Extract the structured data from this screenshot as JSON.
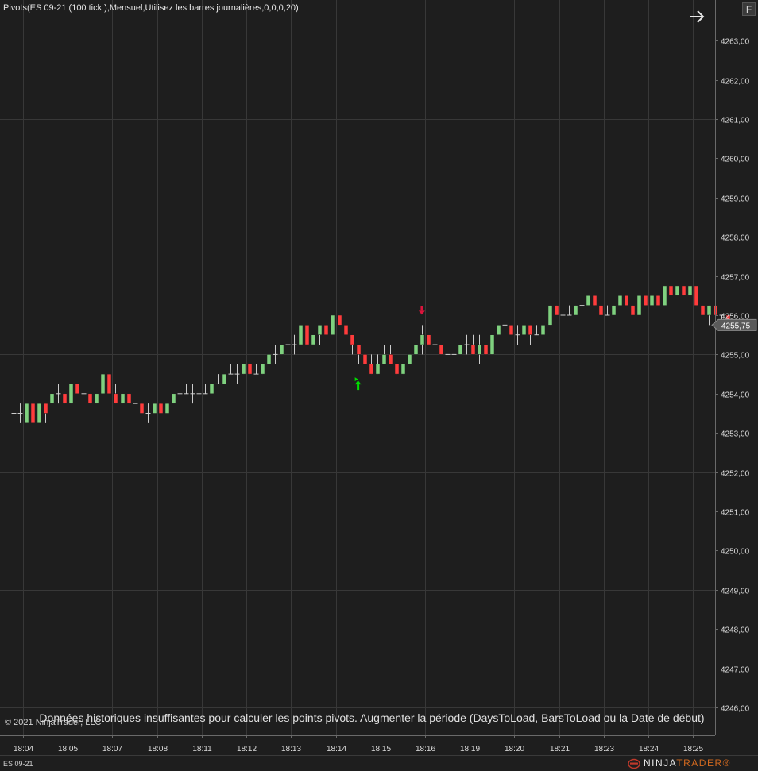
{
  "indicator_title": "Pivots(ES 09-21 (100 tick ),Mensuel,Utilisez les barres journalières,0,0,0,20)",
  "f_button": "F",
  "copyright": "© 2021 NinjaTrader, LLC",
  "warning": "Données historiques insuffisantes pour calculer les points pivots. Augmenter la période (DaysToLoad, BarsToLoad ou la Date de début)",
  "instrument": "ES 09-21",
  "brand": {
    "part1": "NINJA",
    "part2": "TRADER",
    "registered": "®"
  },
  "icons": {
    "scroll": "arrow-right-icon",
    "brand": "ninjatrader-logo-icon",
    "pivot_down": "arrow-down-icon",
    "pivot_up": "arrow-up-icon"
  },
  "colors": {
    "background": "#1e1e1e",
    "grid": "#383838",
    "up": "#7fd17f",
    "down": "#ff3c3c",
    "doji": "#cccccc",
    "arrow_up": "#00dd00",
    "arrow_down": "#dc143c",
    "price_tag": "#5a5a5a"
  },
  "chart_data": {
    "type": "candlestick",
    "instrument": "ES 09-21",
    "bar_period": "100 tick",
    "tick_size": 0.25,
    "ylim": [
      4245.5,
      4263.75
    ],
    "y_ticks": [
      4246.0,
      4247.0,
      4248.0,
      4249.0,
      4250.0,
      4251.0,
      4252.0,
      4253.0,
      4254.0,
      4255.0,
      4256.0,
      4257.0,
      4258.0,
      4259.0,
      4260.0,
      4261.0,
      4262.0,
      4263.0
    ],
    "y_tick_labels": [
      "4246,00",
      "4247,00",
      "4248,00",
      "4249,00",
      "4250,00",
      "4251,00",
      "4252,00",
      "4253,00",
      "4254,00",
      "4255,00",
      "4256,00",
      "4257,00",
      "4258,00",
      "4259,00",
      "4260,00",
      "4261,00",
      "4262,00",
      "4263,00"
    ],
    "x_ticks": [
      {
        "label": "18:04",
        "bar": 1.5
      },
      {
        "label": "18:05",
        "bar": 8.5
      },
      {
        "label": "18:07",
        "bar": 15.5
      },
      {
        "label": "18:08",
        "bar": 22.5
      },
      {
        "label": "18:11",
        "bar": 29.5
      },
      {
        "label": "18:12",
        "bar": 36.5
      },
      {
        "label": "18:13",
        "bar": 43.5
      },
      {
        "label": "18:14",
        "bar": 50.5
      },
      {
        "label": "18:15",
        "bar": 57.5
      },
      {
        "label": "18:16",
        "bar": 64.5
      },
      {
        "label": "18:19",
        "bar": 71.5
      },
      {
        "label": "18:20",
        "bar": 78.5
      },
      {
        "label": "18:21",
        "bar": 85.5
      },
      {
        "label": "18:23",
        "bar": 92.5
      },
      {
        "label": "18:24",
        "bar": 99.5
      },
      {
        "label": "18:25",
        "bar": 106.5
      }
    ],
    "grid": true,
    "last_price": 4255.75,
    "last_price_label": "4255,75",
    "ohlc": [
      [
        4253.5,
        4253.75,
        4253.25,
        4253.5
      ],
      [
        4253.5,
        4253.75,
        4253.25,
        4253.5
      ],
      [
        4253.25,
        4253.75,
        4253.25,
        4253.75
      ],
      [
        4253.75,
        4253.75,
        4253.25,
        4253.25
      ],
      [
        4253.25,
        4253.75,
        4253.25,
        4253.75
      ],
      [
        4253.75,
        4253.75,
        4253.25,
        4253.5
      ],
      [
        4253.75,
        4254.0,
        4253.75,
        4254.0
      ],
      [
        4254.0,
        4254.25,
        4253.75,
        4254.0
      ],
      [
        4254.0,
        4254.0,
        4253.75,
        4253.75
      ],
      [
        4253.75,
        4254.25,
        4253.75,
        4254.25
      ],
      [
        4254.25,
        4254.25,
        4254.0,
        4254.0
      ],
      [
        4254.0,
        4254.0,
        4254.0,
        4254.0
      ],
      [
        4254.0,
        4254.0,
        4253.75,
        4253.75
      ],
      [
        4253.75,
        4254.0,
        4253.75,
        4254.0
      ],
      [
        4254.0,
        4254.5,
        4254.0,
        4254.5
      ],
      [
        4254.5,
        4254.5,
        4254.0,
        4254.0
      ],
      [
        4254.0,
        4254.25,
        4253.75,
        4253.75
      ],
      [
        4253.75,
        4254.0,
        4253.75,
        4254.0
      ],
      [
        4254.0,
        4254.0,
        4253.75,
        4253.75
      ],
      [
        4253.75,
        4253.75,
        4253.75,
        4253.75
      ],
      [
        4253.75,
        4253.75,
        4253.5,
        4253.5
      ],
      [
        4253.5,
        4253.75,
        4253.25,
        4253.5
      ],
      [
        4253.5,
        4253.75,
        4253.5,
        4253.75
      ],
      [
        4253.75,
        4253.75,
        4253.5,
        4253.5
      ],
      [
        4253.5,
        4253.75,
        4253.5,
        4253.75
      ],
      [
        4253.75,
        4254.0,
        4253.75,
        4254.0
      ],
      [
        4254.0,
        4254.25,
        4254.0,
        4254.0
      ],
      [
        4254.0,
        4254.25,
        4254.0,
        4254.0
      ],
      [
        4254.0,
        4254.25,
        4253.75,
        4254.0
      ],
      [
        4254.0,
        4254.0,
        4253.75,
        4254.0
      ],
      [
        4254.0,
        4254.25,
        4254.0,
        4254.0
      ],
      [
        4254.0,
        4254.25,
        4254.0,
        4254.25
      ],
      [
        4254.25,
        4254.5,
        4254.25,
        4254.25
      ],
      [
        4254.25,
        4254.5,
        4254.25,
        4254.5
      ],
      [
        4254.5,
        4254.75,
        4254.5,
        4254.5
      ],
      [
        4254.5,
        4254.75,
        4254.25,
        4254.5
      ],
      [
        4254.5,
        4254.75,
        4254.5,
        4254.75
      ],
      [
        4254.75,
        4254.75,
        4254.5,
        4254.5
      ],
      [
        4254.5,
        4254.75,
        4254.5,
        4254.5
      ],
      [
        4254.5,
        4254.75,
        4254.5,
        4254.75
      ],
      [
        4254.75,
        4255.0,
        4254.75,
        4255.0
      ],
      [
        4255.0,
        4255.25,
        4254.75,
        4255.0
      ],
      [
        4255.0,
        4255.25,
        4255.0,
        4255.25
      ],
      [
        4255.25,
        4255.5,
        4255.25,
        4255.25
      ],
      [
        4255.25,
        4255.5,
        4255.0,
        4255.25
      ],
      [
        4255.25,
        4255.75,
        4255.25,
        4255.75
      ],
      [
        4255.75,
        4255.75,
        4255.25,
        4255.25
      ],
      [
        4255.25,
        4255.5,
        4255.25,
        4255.5
      ],
      [
        4255.5,
        4255.75,
        4255.25,
        4255.75
      ],
      [
        4255.75,
        4255.75,
        4255.5,
        4255.5
      ],
      [
        4255.5,
        4256.0,
        4255.5,
        4256.0
      ],
      [
        4256.0,
        4256.0,
        4255.75,
        4255.75
      ],
      [
        4255.75,
        4255.75,
        4255.25,
        4255.5
      ],
      [
        4255.5,
        4255.5,
        4255.0,
        4255.25
      ],
      [
        4255.25,
        4255.25,
        4254.75,
        4255.0
      ],
      [
        4255.0,
        4255.0,
        4254.5,
        4254.75
      ],
      [
        4254.75,
        4255.0,
        4254.5,
        4254.5
      ],
      [
        4254.5,
        4255.0,
        4254.5,
        4254.75
      ],
      [
        4254.75,
        4255.25,
        4254.75,
        4255.0
      ],
      [
        4255.0,
        4255.25,
        4254.75,
        4254.75
      ],
      [
        4254.75,
        4254.75,
        4254.5,
        4254.5
      ],
      [
        4254.5,
        4254.75,
        4254.5,
        4254.75
      ],
      [
        4254.75,
        4255.0,
        4254.75,
        4255.0
      ],
      [
        4255.0,
        4255.25,
        4255.0,
        4255.25
      ],
      [
        4255.25,
        4255.75,
        4255.0,
        4255.5
      ],
      [
        4255.5,
        4255.5,
        4255.25,
        4255.25
      ],
      [
        4255.25,
        4255.5,
        4255.0,
        4255.25
      ],
      [
        4255.25,
        4255.25,
        4255.0,
        4255.0
      ],
      [
        4255.0,
        4255.0,
        4255.0,
        4255.0
      ],
      [
        4255.0,
        4255.0,
        4255.0,
        4255.0
      ],
      [
        4255.0,
        4255.25,
        4255.0,
        4255.25
      ],
      [
        4255.25,
        4255.5,
        4255.0,
        4255.25
      ],
      [
        4255.25,
        4255.5,
        4255.0,
        4255.0
      ],
      [
        4255.0,
        4255.5,
        4254.75,
        4255.25
      ],
      [
        4255.25,
        4255.25,
        4255.0,
        4255.0
      ],
      [
        4255.0,
        4255.5,
        4255.0,
        4255.5
      ],
      [
        4255.5,
        4255.75,
        4255.5,
        4255.75
      ],
      [
        4255.75,
        4255.75,
        4255.25,
        4255.75
      ],
      [
        4255.75,
        4255.75,
        4255.5,
        4255.5
      ],
      [
        4255.5,
        4255.75,
        4255.25,
        4255.5
      ],
      [
        4255.5,
        4255.75,
        4255.5,
        4255.75
      ],
      [
        4255.75,
        4255.75,
        4255.25,
        4255.5
      ],
      [
        4255.5,
        4255.75,
        4255.5,
        4255.5
      ],
      [
        4255.5,
        4255.75,
        4255.5,
        4255.75
      ],
      [
        4255.75,
        4256.25,
        4255.75,
        4256.25
      ],
      [
        4256.25,
        4256.25,
        4256.0,
        4256.0
      ],
      [
        4256.0,
        4256.25,
        4256.0,
        4256.0
      ],
      [
        4256.0,
        4256.25,
        4256.0,
        4256.0
      ],
      [
        4256.0,
        4256.25,
        4256.0,
        4256.25
      ],
      [
        4256.25,
        4256.5,
        4256.25,
        4256.25
      ],
      [
        4256.25,
        4256.5,
        4256.25,
        4256.5
      ],
      [
        4256.5,
        4256.5,
        4256.25,
        4256.25
      ],
      [
        4256.25,
        4256.25,
        4256.0,
        4256.0
      ],
      [
        4256.0,
        4256.25,
        4256.0,
        4256.0
      ],
      [
        4256.0,
        4256.25,
        4256.0,
        4256.25
      ],
      [
        4256.25,
        4256.5,
        4256.25,
        4256.5
      ],
      [
        4256.5,
        4256.5,
        4256.25,
        4256.25
      ],
      [
        4256.25,
        4256.25,
        4256.0,
        4256.0
      ],
      [
        4256.0,
        4256.5,
        4256.0,
        4256.5
      ],
      [
        4256.5,
        4256.5,
        4256.25,
        4256.25
      ],
      [
        4256.25,
        4256.75,
        4256.25,
        4256.5
      ],
      [
        4256.5,
        4256.5,
        4256.25,
        4256.25
      ],
      [
        4256.25,
        4256.75,
        4256.25,
        4256.75
      ],
      [
        4256.75,
        4256.75,
        4256.5,
        4256.5
      ],
      [
        4256.5,
        4256.75,
        4256.5,
        4256.75
      ],
      [
        4256.75,
        4256.75,
        4256.5,
        4256.5
      ],
      [
        4256.5,
        4257.0,
        4256.5,
        4256.75
      ],
      [
        4256.75,
        4256.75,
        4256.25,
        4256.25
      ],
      [
        4256.25,
        4256.25,
        4256.0,
        4256.0
      ],
      [
        4256.0,
        4256.25,
        4255.75,
        4256.25
      ],
      [
        4256.25,
        4256.25,
        4255.75,
        4256.0
      ],
      [
        4256.0,
        4256.0,
        4255.75,
        4256.0
      ],
      [
        4256.0,
        4256.0,
        4255.75,
        4255.75
      ]
    ],
    "markers": [
      {
        "type": "down",
        "bar": 64,
        "price": 4255.75
      },
      {
        "type": "up",
        "bar": 54,
        "price": 4254.5
      }
    ]
  }
}
